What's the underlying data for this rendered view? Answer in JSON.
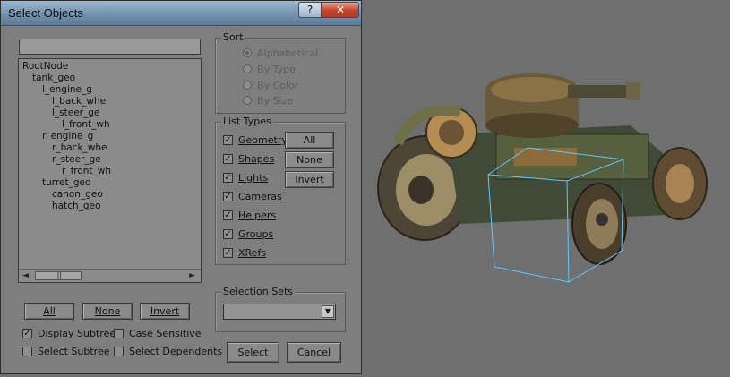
{
  "dialog": {
    "title": "Select Objects",
    "help_label": "?",
    "close_label": "✕"
  },
  "search": {
    "value": "",
    "placeholder": ""
  },
  "tree": {
    "items": [
      {
        "label": "RootNode",
        "depth": 0
      },
      {
        "label": "tank_geo",
        "depth": 1
      },
      {
        "label": "l_engine_g",
        "depth": 2
      },
      {
        "label": "l_back_whe",
        "depth": 3
      },
      {
        "label": "l_steer_ge",
        "depth": 3
      },
      {
        "label": "l_front_wh",
        "depth": 4
      },
      {
        "label": "r_engine_g",
        "depth": 2
      },
      {
        "label": "r_back_whe",
        "depth": 3
      },
      {
        "label": "r_steer_ge",
        "depth": 3
      },
      {
        "label": "r_front_wh",
        "depth": 4
      },
      {
        "label": "turret_geo",
        "depth": 2
      },
      {
        "label": "canon_geo",
        "depth": 3
      },
      {
        "label": "hatch_geo",
        "depth": 3
      }
    ],
    "scroll_thumb": "|||",
    "scroll_left": "◄",
    "scroll_right": "►"
  },
  "sort": {
    "title": "Sort",
    "options": [
      {
        "label": "Alphabetical",
        "checked": true
      },
      {
        "label": "By Type",
        "checked": false
      },
      {
        "label": "By Color",
        "checked": false
      },
      {
        "label": "By Size",
        "checked": false
      }
    ]
  },
  "list_types": {
    "title": "List Types",
    "items": [
      {
        "label": "Geometry",
        "checked": true
      },
      {
        "label": "Shapes",
        "checked": true
      },
      {
        "label": "Lights",
        "checked": true
      },
      {
        "label": "Cameras",
        "checked": true
      },
      {
        "label": "Helpers",
        "checked": true
      },
      {
        "label": "Groups",
        "checked": true
      },
      {
        "label": "XRefs",
        "checked": true
      }
    ],
    "buttons": {
      "all": "All",
      "none": "None",
      "invert": "Invert"
    }
  },
  "selection_buttons": {
    "all": "All",
    "none": "None",
    "invert": "Invert"
  },
  "options": {
    "display_subtree": {
      "label": "Display Subtree",
      "checked": true
    },
    "case_sensitive": {
      "label": "Case Sensitive",
      "checked": false
    },
    "select_subtree": {
      "label": "Select Subtree",
      "checked": false
    },
    "select_dependents": {
      "label": "Select Dependents",
      "checked": false
    }
  },
  "selection_sets": {
    "title": "Selection Sets",
    "value": "",
    "arrow": "▼"
  },
  "actions": {
    "select": "Select",
    "cancel": "Cancel"
  },
  "check_mark": "✓",
  "colors": {
    "bounding_box": "#5ec8ff",
    "dialog_bg": "#7e7e7e",
    "viewport_bg": "#6f6f6f"
  }
}
